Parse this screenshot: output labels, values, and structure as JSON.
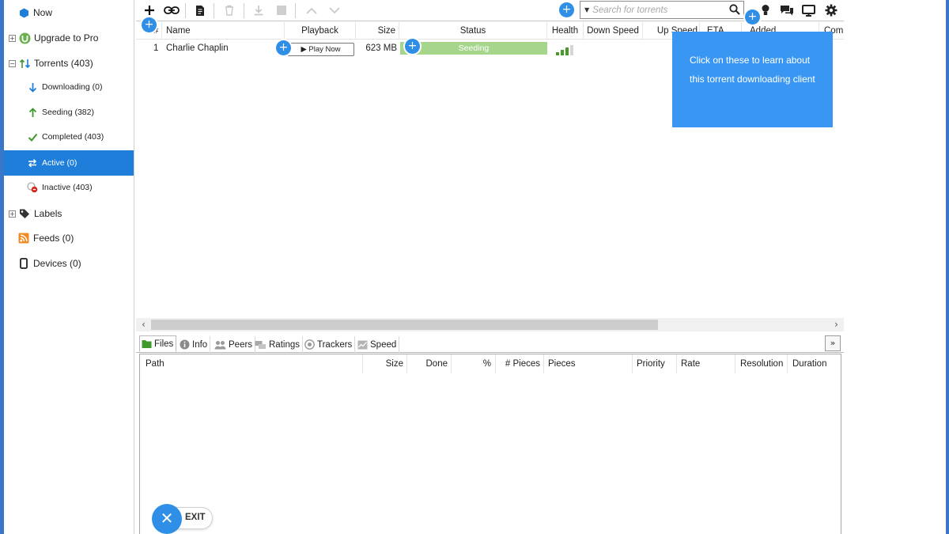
{
  "sidebar": {
    "items": [
      {
        "label": "Now",
        "icon": "blue-hexagon-icon"
      },
      {
        "label": "Upgrade to Pro",
        "icon": "utorrent-logo-icon",
        "expander": "+"
      },
      {
        "label": "Torrents (403)",
        "icon": "torrents-arrows-icon",
        "expander": "−"
      },
      {
        "label": "Downloading (0)",
        "icon": "arrow-down-icon"
      },
      {
        "label": "Seeding (382)",
        "icon": "arrow-up-icon"
      },
      {
        "label": "Completed (403)",
        "icon": "checkmark-icon"
      },
      {
        "label": "Active (0)",
        "icon": "active-arrows-icon",
        "active": true
      },
      {
        "label": "Inactive (403)",
        "icon": "inactive-icon"
      },
      {
        "label": "Labels",
        "icon": "tag-icon",
        "expander": "+"
      },
      {
        "label": "Feeds (0)",
        "icon": "rss-icon"
      },
      {
        "label": "Devices (0)",
        "icon": "device-icon"
      }
    ]
  },
  "toolbar": {
    "search_placeholder": "Search for torrents",
    "buttons": [
      "add-icon",
      "link-icon",
      "file-icon",
      "trash-icon",
      "download-icon",
      "stop-icon",
      "chevron-up-icon",
      "chevron-down-icon"
    ],
    "right_icons": [
      "lightbulb-icon",
      "chat-icon",
      "monitor-icon",
      "gear-icon"
    ]
  },
  "table": {
    "columns": [
      "#",
      "Name",
      "Playback",
      "Size",
      "Status",
      "Health",
      "Down Speed",
      "Up Speed",
      "ETA",
      "Added",
      "Com"
    ],
    "rows": [
      {
        "index": "1",
        "name": "Charlie Chaplin",
        "playback": "▶ Play Now",
        "size": "623 MB",
        "status": "Seeding",
        "health_bars": 3
      }
    ]
  },
  "tooltip": {
    "text": "Click on these to learn about this torrent downloading client"
  },
  "details": {
    "tabs": [
      "Files",
      "Info",
      "Peers",
      "Ratings",
      "Trackers",
      "Speed"
    ],
    "active_tab": "Files",
    "file_columns": [
      "Path",
      "Size",
      "Done",
      "%",
      "# Pieces",
      "Pieces",
      "Priority",
      "Rate",
      "Resolution",
      "Duration"
    ]
  },
  "exit": {
    "label": "EXIT",
    "icon": "close-icon"
  },
  "colors": {
    "accent": "#1e7ed9",
    "hint": "#2f8fe6",
    "tooltip": "#3a96f3",
    "status_seeding": "#a6d68b",
    "health": "#4a9a2a"
  }
}
